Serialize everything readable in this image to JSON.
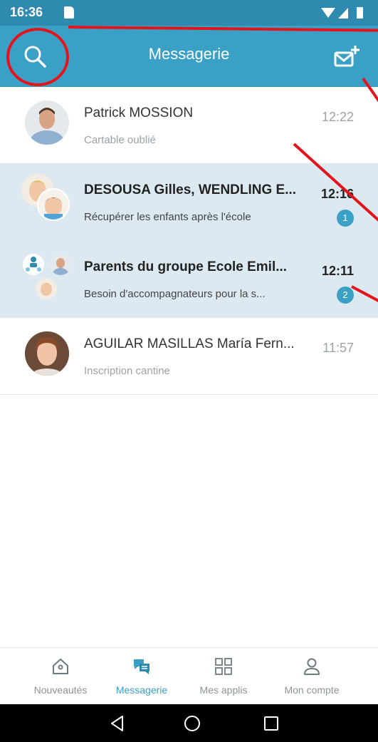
{
  "status_bar": {
    "time": "16:36"
  },
  "app_bar": {
    "title": "Messagerie"
  },
  "conversations": [
    {
      "name": "Patrick MOSSION",
      "preview": "Cartable oublié",
      "time": "12:22",
      "unread": false,
      "badge": null
    },
    {
      "name": "DESOUSA Gilles, WENDLING E...",
      "preview": "Récupérer les enfants après l'école",
      "time": "12:16",
      "unread": true,
      "badge": "1"
    },
    {
      "name": "Parents du groupe Ecole Emil...",
      "preview": "Besoin d'accompagnateurs pour la s...",
      "time": "12:11",
      "unread": true,
      "badge": "2"
    },
    {
      "name": "AGUILAR MASILLAS María Fern...",
      "preview": "Inscription cantine",
      "time": "11:57",
      "unread": false,
      "badge": null
    }
  ],
  "bottom_nav": [
    {
      "label": "Nouveautés",
      "icon": "home-icon",
      "active": false
    },
    {
      "label": "Messagerie",
      "icon": "messages-icon",
      "active": true
    },
    {
      "label": "Mes applis",
      "icon": "apps-grid-icon",
      "active": false
    },
    {
      "label": "Mon compte",
      "icon": "user-icon",
      "active": false
    }
  ],
  "colors": {
    "status_bar": "#2f8ab0",
    "app_bar": "#3aa0c6",
    "unread_row": "#dde9f0",
    "accent": "#3aa0c6",
    "annotation": "#e3141b"
  }
}
